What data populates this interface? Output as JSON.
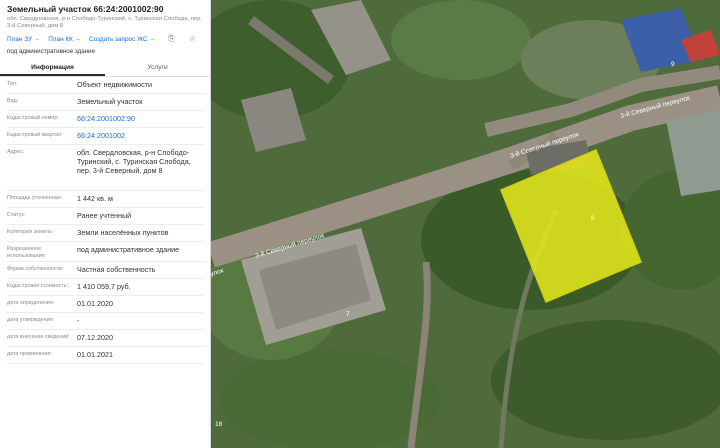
{
  "header": {
    "title": "Земельный участок 66:24:2001002:90",
    "address": "обл. Свердловская, р-н Слободо-Туринский, с. Туринская Слобода, пер. 3-й Северный, дом 8",
    "links": [
      "План ЗУ →",
      "План КК →",
      "Создать запрос ЖС →"
    ],
    "purpose": "под административное здание"
  },
  "tabs": [
    "Информация",
    "Услуги"
  ],
  "rows": [
    {
      "label": "Тип:",
      "value": "Объект недвижимости"
    },
    {
      "label": "Вид:",
      "value": "Земельный участок"
    },
    {
      "label": "Кадастровый номер:",
      "value": "66:24:2001002:90",
      "link": true
    },
    {
      "label": "Кадастровый квартал:",
      "value": "66:24:2001002",
      "link": true
    },
    {
      "label": "Адрес:",
      "value": "обл. Свердловская, р-н Слободо-Туринский, с. Туринская Слобода, пер. 3-й Северный, дом 8"
    },
    {
      "label": "Площадь уточненная:",
      "value": "1 442 кв. м"
    },
    {
      "label": "Статус:",
      "value": "Ранее учтенный"
    },
    {
      "label": "Категория земель:",
      "value": "Земли населённых пунктов"
    },
    {
      "label": "Разрешенное использование:",
      "value": "под административное здание"
    },
    {
      "label": "Форма собственности:",
      "value": "Частная собственность"
    },
    {
      "label": "Кадастровая стоимость:",
      "value": "1 410 059,7 руб."
    },
    {
      "label": "дата определения:",
      "value": "01.01.2020"
    },
    {
      "label": "дата утверждения:",
      "value": "-"
    },
    {
      "label": "дата внесения сведений:",
      "value": "07.12.2020"
    },
    {
      "label": "дата применения:",
      "value": "01.01.2021"
    }
  ],
  "map": {
    "street_labels": [
      "3-й Северный переулок",
      "3-й Северный переулок",
      "3-й Северный переулок",
      "улок"
    ],
    "house_numbers": [
      "8",
      "7",
      "9",
      "18"
    ],
    "parcel_color": "#e8ec1a"
  }
}
